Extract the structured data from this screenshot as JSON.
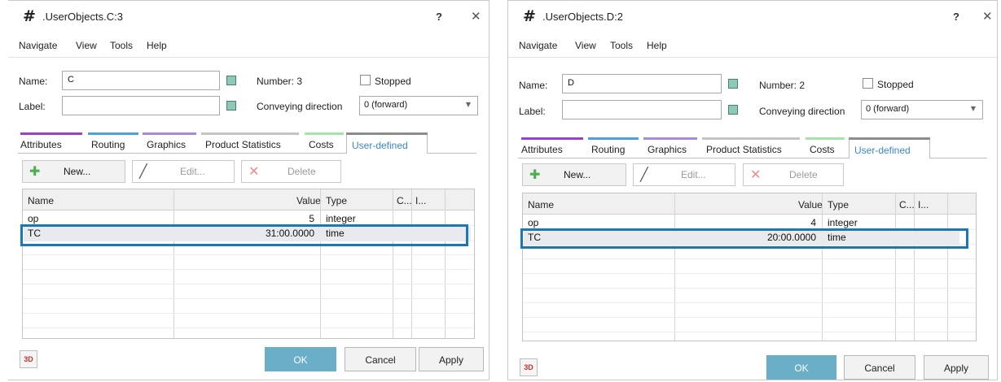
{
  "left_dialog": {
    "title": ".UserObjects.C:3",
    "help": "?",
    "close": "✕",
    "menu": [
      "Navigate",
      "View",
      "Tools",
      "Help"
    ],
    "name_label": "Name:",
    "name_value": "C",
    "label_label": "Label:",
    "label_value": "",
    "number_text": "Number: 3",
    "stopped_label": "Stopped",
    "conveying_label": "Conveying direction",
    "conveying_value": "0 (forward)",
    "tabs": [
      "Attributes",
      "Routing",
      "Graphics",
      "Product Statistics",
      "Costs",
      "User-defined"
    ],
    "toolbar": {
      "new": "New...",
      "edit": "Edit...",
      "delete": "Delete"
    },
    "columns": [
      "Name",
      "Value",
      "Type",
      "C...",
      "I..."
    ],
    "rows": [
      {
        "name": "op",
        "value": "5",
        "type": "integer"
      },
      {
        "name": "TC",
        "value": "31:00.0000",
        "type": "time"
      }
    ],
    "icon3d": "3D",
    "ok": "OK",
    "cancel": "Cancel",
    "apply": "Apply"
  },
  "right_dialog": {
    "title": ".UserObjects.D:2",
    "help": "?",
    "close": "✕",
    "menu": [
      "Navigate",
      "View",
      "Tools",
      "Help"
    ],
    "name_label": "Name:",
    "name_value": "D",
    "label_label": "Label:",
    "label_value": "",
    "number_text": "Number: 2",
    "stopped_label": "Stopped",
    "conveying_label": "Conveying direction",
    "conveying_value": "0 (forward)",
    "tabs": [
      "Attributes",
      "Routing",
      "Graphics",
      "Product Statistics",
      "Costs",
      "User-defined"
    ],
    "toolbar": {
      "new": "New...",
      "edit": "Edit...",
      "delete": "Delete"
    },
    "columns": [
      "Name",
      "Value",
      "Type",
      "C...",
      "I..."
    ],
    "rows": [
      {
        "name": "op",
        "value": "4",
        "type": "integer"
      },
      {
        "name": "TC",
        "value": "20:00.0000",
        "type": "time"
      }
    ],
    "icon3d": "3D",
    "ok": "OK",
    "cancel": "Cancel",
    "apply": "Apply"
  },
  "colors": {
    "tab_attributes": "#9b3fd0",
    "tab_routing": "#4aa3df",
    "tab_graphics": "#a98adf",
    "tab_product_statistics": "#c4c4c4",
    "tab_costs": "#a6e3a6",
    "tab_user_defined": "#8c8c8c",
    "ok_button": "#6aaec8",
    "selection_outline": "#1b78b8",
    "new_icon": "#4caf50",
    "delete_icon": "#f08a8a"
  },
  "icons": {
    "window": "hash-icon",
    "new": "plus-icon",
    "edit": "pencil-icon",
    "delete": "x-icon",
    "inherit": "inherit-icon"
  }
}
